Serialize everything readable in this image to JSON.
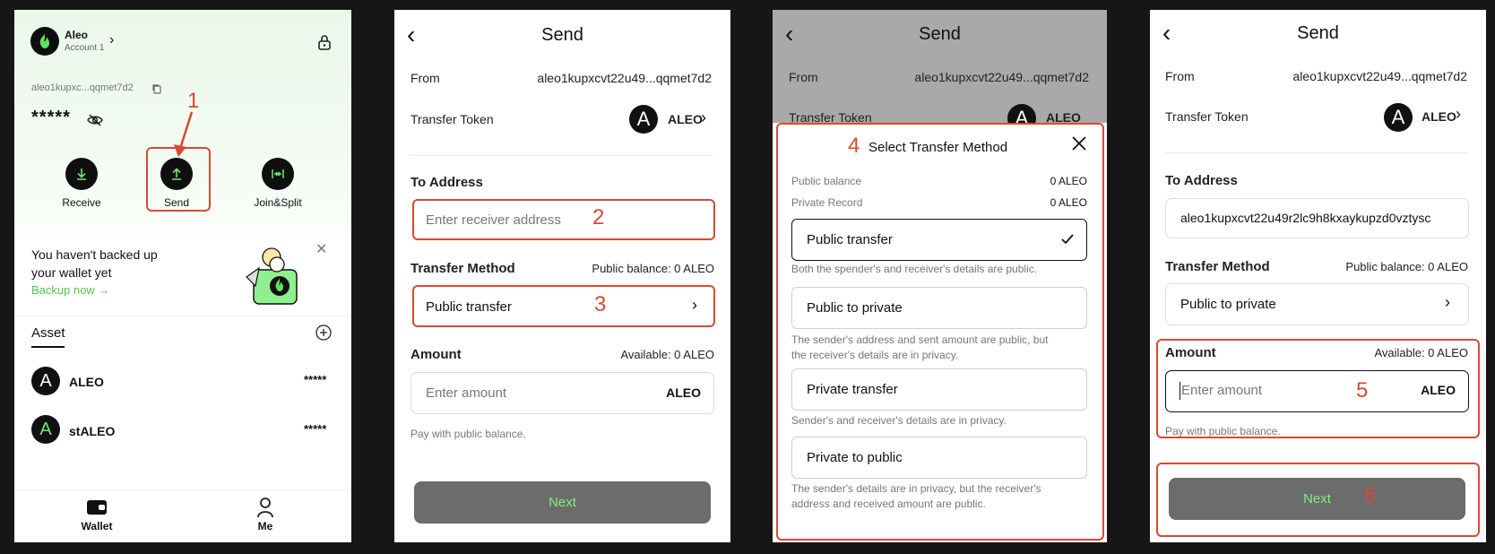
{
  "wallet": {
    "account_name": "Aleo",
    "account_sub": "Account 1",
    "address_short": "aleo1kupxc...qqmet7d2",
    "balance_masked": "*****",
    "actions": [
      "Receive",
      "Send",
      "Join&Split"
    ],
    "backup_text_line1": "You haven't backed up",
    "backup_text_line2": "your wallet yet",
    "backup_link": "Backup now →",
    "asset_tab": "Asset",
    "assets": [
      {
        "name": "ALEO",
        "value": "*****"
      },
      {
        "name": "stALEO",
        "value": "*****"
      }
    ],
    "nav": [
      "Wallet",
      "Me"
    ]
  },
  "annotations": [
    "1",
    "2",
    "3",
    "4",
    "5",
    "6"
  ],
  "send": {
    "title": "Send",
    "from_label": "From",
    "from_value": "aleo1kupxcvt22u49...qqmet7d2",
    "token_label": "Transfer Token",
    "token_value": "ALEO",
    "to_label": "To Address",
    "to_placeholder": "Enter receiver address",
    "method_label": "Transfer Method",
    "public_balance": "Public balance: 0 ALEO",
    "method_value_2": "Public transfer",
    "amount_label": "Amount",
    "available": "Available: 0 ALEO",
    "amount_placeholder": "Enter amount",
    "amount_unit": "ALEO",
    "pay_note": "Pay with public balance.",
    "next_label": "Next"
  },
  "modal": {
    "title": "Select Transfer Method",
    "public_balance_label": "Public balance",
    "public_balance_value": "0 ALEO",
    "private_record_label": "Private Record",
    "private_record_value": "0 ALEO",
    "options": [
      {
        "label": "Public transfer",
        "desc1": "Both the spender's and receiver's details are public.",
        "desc2": ""
      },
      {
        "label": "Public to private",
        "desc1": "The sender's address and sent amount are public, but",
        "desc2": "the receiver's details are in privacy."
      },
      {
        "label": "Private transfer",
        "desc1": "Sender's and receiver's details are in privacy.",
        "desc2": ""
      },
      {
        "label": "Private to public",
        "desc1": "The sender's details are in privacy, but the receiver's",
        "desc2": "address and received amount are public."
      }
    ]
  },
  "send4": {
    "to_value": "aleo1kupxcvt22u49r2lc9h8kxaykupzd0vztysc",
    "method_value": "Public to private"
  },
  "colors": {
    "accent_green": "#7ff27f",
    "annotation_red": "#d94a33"
  }
}
